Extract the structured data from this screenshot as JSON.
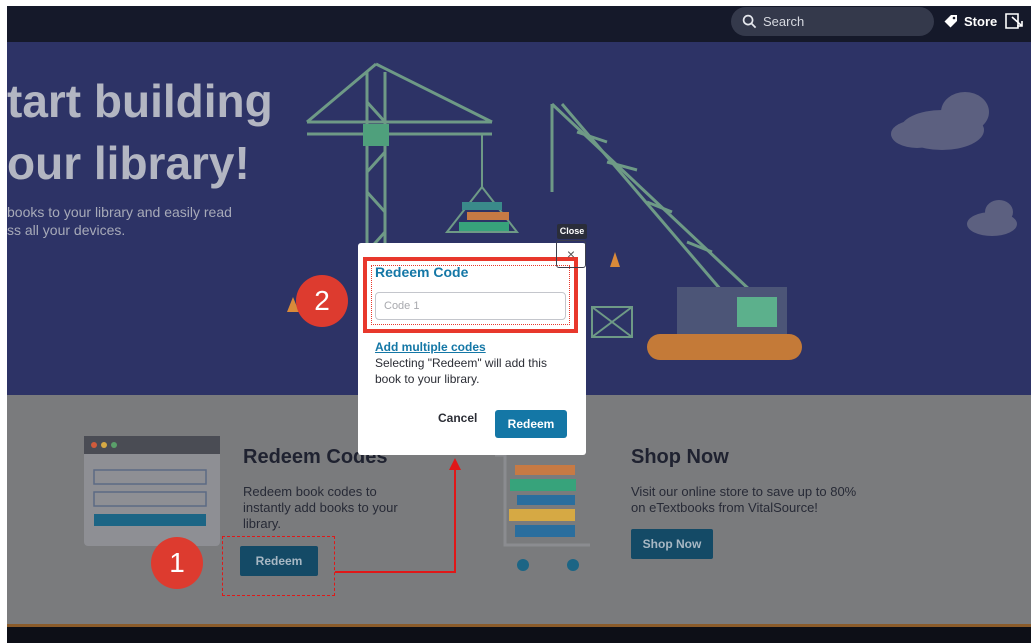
{
  "topbar": {
    "search_placeholder": "Search",
    "store_label": "Store",
    "icons": [
      "search-icon",
      "tag-icon",
      "logout-icon"
    ]
  },
  "hero": {
    "title_line1": "tart building",
    "title_line2": "our library!",
    "subtitle_line1": "books to your library and easily read",
    "subtitle_line2": "ss all your devices."
  },
  "redeem_card": {
    "title": "Redeem Codes",
    "text": "Redeem book codes to instantly add books to your library.",
    "button_label": "Redeem"
  },
  "shop_card": {
    "title": "Shop Now",
    "text": "Visit our online store to save up to 80% on eTextbooks from VitalSource!",
    "button_label": "Shop Now"
  },
  "modal": {
    "title": "Redeem Code",
    "input_placeholder": "Code 1",
    "add_multiple_label": "Add multiple codes",
    "note": "Selecting \"Redeem\" will add this book to your library.",
    "cancel_label": "Cancel",
    "redeem_label": "Redeem",
    "close_tooltip": "Close",
    "close_glyph": "×"
  },
  "annotations": {
    "badge_1": "1",
    "badge_2": "2"
  },
  "colors": {
    "hero_bg": "#2d3366",
    "accent": "#1477a6",
    "annotation_red": "#e8382c",
    "badge_red": "#dd3b2f"
  }
}
